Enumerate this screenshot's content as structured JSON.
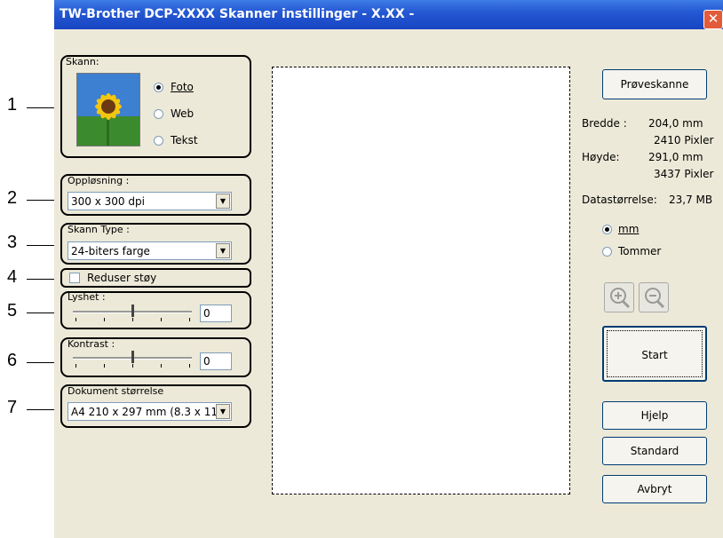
{
  "window": {
    "title": "TW-Brother DCP-XXXX Skanner instillinger - X.XX -",
    "close_symbol": "✕"
  },
  "callouts": [
    "1",
    "2",
    "3",
    "4",
    "5",
    "6",
    "7"
  ],
  "scan": {
    "label": "Skann:",
    "options": [
      {
        "label": "Foto",
        "selected": true
      },
      {
        "label": "Web",
        "selected": false
      },
      {
        "label": "Tekst",
        "selected": false
      }
    ]
  },
  "resolution": {
    "label": "Oppløsning :",
    "value": "300 x 300 dpi"
  },
  "scan_type": {
    "label": "Skann Type :",
    "value": "24-biters farge"
  },
  "noise": {
    "label": "Reduser støy",
    "checked": false
  },
  "brightness": {
    "label": "Lyshet :",
    "value": "0"
  },
  "contrast": {
    "label": "Kontrast :",
    "value": "0"
  },
  "doc_size": {
    "label": "Dokument størrelse",
    "value": "A4 210 x 297 mm (8.3 x 11."
  },
  "right": {
    "prescan_label": "Prøveskanne",
    "width_label": "Bredde :",
    "width_mm": "204,0 mm",
    "width_px": "2410 Pixler",
    "height_label": "Høyde:",
    "height_mm": "291,0 mm",
    "height_px": "3437 Pixler",
    "datasize_label": "Datastørrelse:",
    "datasize_value": "23,7 MB",
    "units": [
      {
        "label": "mm",
        "selected": true
      },
      {
        "label": "Tommer",
        "selected": false
      }
    ],
    "start_label": "Start",
    "help_label": "Hjelp",
    "default_label": "Standard",
    "cancel_label": "Avbryt"
  },
  "icons": [
    "zoom-in-icon",
    "zoom-out-icon",
    "sunflower-photo-icon",
    "close-icon"
  ]
}
